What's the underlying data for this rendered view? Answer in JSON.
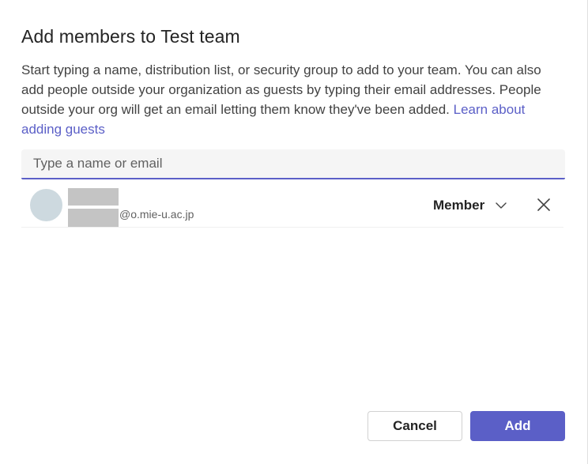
{
  "dialog": {
    "title": "Add members to Test team",
    "description": "Start typing a name, distribution list, or security group to add to your team. You can also add people outside your organization as guests by typing their email addresses. People outside your org will get an email letting them know they've been added.",
    "learn_more_link": "Learn about adding guests"
  },
  "search": {
    "placeholder": "Type a name or email",
    "value": ""
  },
  "members": [
    {
      "email_domain": "@o.mie-u.ac.jp",
      "role": "Member"
    }
  ],
  "buttons": {
    "cancel": "Cancel",
    "add": "Add"
  },
  "colors": {
    "accent": "#5b5fc7",
    "avatar_bg": "#cdd9df",
    "redaction": "#c4c4c4"
  },
  "icons": {
    "role_dropdown": "chevron-down-icon",
    "remove_member": "close-icon"
  }
}
